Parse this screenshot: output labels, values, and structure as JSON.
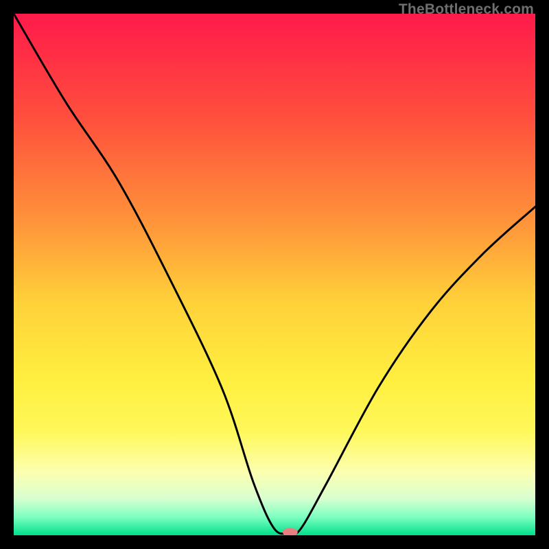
{
  "watermark": "TheBottleneck.com",
  "chart_data": {
    "type": "line",
    "title": "",
    "xlabel": "",
    "ylabel": "",
    "xlim": [
      0,
      100
    ],
    "ylim": [
      0,
      100
    ],
    "background_gradient": {
      "stops": [
        {
          "offset": 0.0,
          "color": "#ff1a4b"
        },
        {
          "offset": 0.2,
          "color": "#ff4f3d"
        },
        {
          "offset": 0.4,
          "color": "#ff943a"
        },
        {
          "offset": 0.55,
          "color": "#ffd03a"
        },
        {
          "offset": 0.7,
          "color": "#ffef3f"
        },
        {
          "offset": 0.8,
          "color": "#fff85a"
        },
        {
          "offset": 0.88,
          "color": "#fcffb0"
        },
        {
          "offset": 0.93,
          "color": "#d8ffd0"
        },
        {
          "offset": 0.965,
          "color": "#7dffc0"
        },
        {
          "offset": 1.0,
          "color": "#00e08c"
        }
      ]
    },
    "series": [
      {
        "name": "bottleneck-curve",
        "x": [
          0,
          10,
          20,
          30,
          40,
          46,
          50,
          53,
          55,
          60,
          70,
          80,
          90,
          100
        ],
        "y": [
          100,
          83,
          68,
          49,
          28,
          10,
          1.2,
          0.6,
          1.2,
          10,
          28.5,
          43,
          54,
          63
        ]
      }
    ],
    "marker": {
      "x": 53,
      "y": 0.6,
      "color": "#e98080",
      "rx": 11,
      "ry": 6
    }
  }
}
